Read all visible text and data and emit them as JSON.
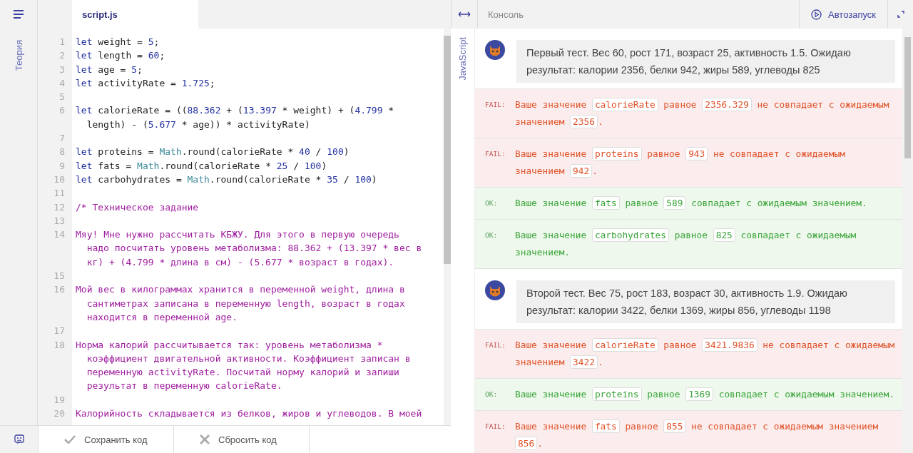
{
  "sidebar": {
    "label": "Теория"
  },
  "editor": {
    "tab": "script.js",
    "lines": [
      {
        "n": "1",
        "tokens": [
          {
            "kind": "kw",
            "t": "let"
          },
          {
            "kind": "id",
            "t": " weight = "
          },
          {
            "kind": "num",
            "t": "5"
          },
          {
            "kind": "id",
            "t": ";"
          }
        ]
      },
      {
        "n": "2",
        "tokens": [
          {
            "kind": "kw",
            "t": "let"
          },
          {
            "kind": "id",
            "t": " length = "
          },
          {
            "kind": "num",
            "t": "60"
          },
          {
            "kind": "id",
            "t": ";"
          }
        ]
      },
      {
        "n": "3",
        "tokens": [
          {
            "kind": "kw",
            "t": "let"
          },
          {
            "kind": "id",
            "t": " age = "
          },
          {
            "kind": "num",
            "t": "5"
          },
          {
            "kind": "id",
            "t": ";"
          }
        ]
      },
      {
        "n": "4",
        "tokens": [
          {
            "kind": "kw",
            "t": "let"
          },
          {
            "kind": "id",
            "t": " activityRate = "
          },
          {
            "kind": "num",
            "t": "1.725"
          },
          {
            "kind": "id",
            "t": ";"
          }
        ]
      },
      {
        "n": "5"
      },
      {
        "n": "6",
        "tokens": [
          {
            "kind": "kw",
            "t": "let"
          },
          {
            "kind": "id",
            "t": " calorieRate = (("
          },
          {
            "kind": "num",
            "t": "88.362"
          },
          {
            "kind": "id",
            "t": " + ("
          },
          {
            "kind": "num",
            "t": "13.397"
          },
          {
            "kind": "id",
            "t": " * weight) + ("
          },
          {
            "kind": "num",
            "t": "4.799"
          },
          {
            "kind": "id",
            "t": " * length) - ("
          },
          {
            "kind": "num",
            "t": "5.677"
          },
          {
            "kind": "id",
            "t": " * age)) * activityRate)"
          }
        ]
      },
      {
        "n": "7"
      },
      {
        "n": "8",
        "tokens": [
          {
            "kind": "kw",
            "t": "let"
          },
          {
            "kind": "id",
            "t": " proteins = "
          },
          {
            "kind": "fn",
            "t": "Math"
          },
          {
            "kind": "id",
            "t": ".round(calorieRate * "
          },
          {
            "kind": "num",
            "t": "40"
          },
          {
            "kind": "id",
            "t": " / "
          },
          {
            "kind": "num",
            "t": "100"
          },
          {
            "kind": "id",
            "t": ")"
          }
        ]
      },
      {
        "n": "9",
        "tokens": [
          {
            "kind": "kw",
            "t": "let"
          },
          {
            "kind": "id",
            "t": " fats = "
          },
          {
            "kind": "fn",
            "t": "Math"
          },
          {
            "kind": "id",
            "t": ".round(calorieRate * "
          },
          {
            "kind": "num",
            "t": "25"
          },
          {
            "kind": "id",
            "t": " / "
          },
          {
            "kind": "num",
            "t": "100"
          },
          {
            "kind": "id",
            "t": ")"
          }
        ]
      },
      {
        "n": "10",
        "tokens": [
          {
            "kind": "kw",
            "t": "let"
          },
          {
            "kind": "id",
            "t": " carbohydrates = "
          },
          {
            "kind": "fn",
            "t": "Math"
          },
          {
            "kind": "id",
            "t": ".round(calorieRate * "
          },
          {
            "kind": "num",
            "t": "35"
          },
          {
            "kind": "id",
            "t": " / "
          },
          {
            "kind": "num",
            "t": "100"
          },
          {
            "kind": "id",
            "t": ")"
          }
        ]
      },
      {
        "n": "11"
      },
      {
        "n": "12",
        "tokens": [
          {
            "kind": "comment",
            "t": "/* Техническое задание"
          }
        ]
      },
      {
        "n": "13"
      },
      {
        "n": "14",
        "tokens": [
          {
            "kind": "comment",
            "t": "Мяу! Мне нужно рассчитать КБЖУ. Для этого в первую очередь надо посчитать уровень метаболизма: 88.362 + (13.397 * вес в кг) + (4.799 * длина в см) - (5.677 * возраст в годах)."
          }
        ]
      },
      {
        "n": "15"
      },
      {
        "n": "16",
        "tokens": [
          {
            "kind": "comment",
            "t": "Мой вес в килограммах хранится в переменной weight, длина в сантиметрах записана в переменную length, возраст в годах находится в переменной age."
          }
        ]
      },
      {
        "n": "17"
      },
      {
        "n": "18",
        "tokens": [
          {
            "kind": "comment",
            "t": "Норма калорий рассчитывается так: уровень метаболизма * коэффициент двигательной активности. Коэффициент записан в переменную activityRate. Посчитай норму калорий и запиши результат в переменную calorieRate."
          }
        ]
      },
      {
        "n": "19"
      },
      {
        "n": "20",
        "tokens": [
          {
            "kind": "comment",
            "t": "Калорийность складывается из белков, жиров и углеводов. В моей"
          }
        ]
      }
    ]
  },
  "footer": {
    "save": "Сохранить код",
    "reset": "Сбросить код"
  },
  "language": "JavaScript",
  "console": {
    "title": "Консоль",
    "autorun": "Автозапуск",
    "messages": [
      {
        "kind": "test",
        "text": "Первый тест. Вес 60, рост 171, возраст 25, активность 1.5. Ожидаю результат: калории 2356, белки 942, жиры 589, углеводы 825"
      },
      {
        "kind": "fail",
        "label": "FAIL:",
        "parts": [
          {
            "kind": "text",
            "t": "Ваше значение "
          },
          {
            "kind": "code",
            "t": "calorieRate"
          },
          {
            "kind": "text",
            "t": " равное "
          },
          {
            "kind": "code",
            "t": "2356.329"
          },
          {
            "kind": "text",
            "t": " не совпадает с ожидаемым значением "
          },
          {
            "kind": "code",
            "t": "2356"
          },
          {
            "kind": "text",
            "t": "."
          }
        ]
      },
      {
        "kind": "fail",
        "label": "FAIL:",
        "parts": [
          {
            "kind": "text",
            "t": "Ваше значение "
          },
          {
            "kind": "code",
            "t": "proteins"
          },
          {
            "kind": "text",
            "t": " равное "
          },
          {
            "kind": "code",
            "t": "943"
          },
          {
            "kind": "text",
            "t": " не совпадает с ожидаемым значением "
          },
          {
            "kind": "code",
            "t": "942"
          },
          {
            "kind": "text",
            "t": "."
          }
        ]
      },
      {
        "kind": "ok",
        "label": "OK:",
        "parts": [
          {
            "kind": "text",
            "t": "Ваше значение "
          },
          {
            "kind": "code",
            "t": "fats"
          },
          {
            "kind": "text",
            "t": " равное "
          },
          {
            "kind": "code",
            "t": "589"
          },
          {
            "kind": "text",
            "t": " совпадает с ожидаемым значением."
          }
        ]
      },
      {
        "kind": "ok",
        "label": "OK:",
        "parts": [
          {
            "kind": "text",
            "t": "Ваше значение "
          },
          {
            "kind": "code",
            "t": "carbohydrates"
          },
          {
            "kind": "text",
            "t": " равное "
          },
          {
            "kind": "code",
            "t": "825"
          },
          {
            "kind": "text",
            "t": " совпадает с ожидаемым значением."
          }
        ]
      },
      {
        "kind": "test",
        "text": "Второй тест. Вес 75, рост 183, возраст 30, активность 1.9. Ожидаю результат: калории 3422, белки 1369, жиры 856, углеводы 1198"
      },
      {
        "kind": "fail",
        "label": "FAIL:",
        "parts": [
          {
            "kind": "text",
            "t": "Ваше значение "
          },
          {
            "kind": "code",
            "t": "calorieRate"
          },
          {
            "kind": "text",
            "t": " равное "
          },
          {
            "kind": "code",
            "t": "3421.9836"
          },
          {
            "kind": "text",
            "t": " не совпадает с ожидаемым значением "
          },
          {
            "kind": "code",
            "t": "3422"
          },
          {
            "kind": "text",
            "t": "."
          }
        ]
      },
      {
        "kind": "ok",
        "label": "OK:",
        "parts": [
          {
            "kind": "text",
            "t": "Ваше значение "
          },
          {
            "kind": "code",
            "t": "proteins"
          },
          {
            "kind": "text",
            "t": " равное "
          },
          {
            "kind": "code",
            "t": "1369"
          },
          {
            "kind": "text",
            "t": " совпадает с ожидаемым значением."
          }
        ]
      },
      {
        "kind": "fail",
        "label": "FAIL:",
        "parts": [
          {
            "kind": "text",
            "t": "Ваше значение "
          },
          {
            "kind": "code",
            "t": "fats"
          },
          {
            "kind": "text",
            "t": " равное "
          },
          {
            "kind": "code",
            "t": "855"
          },
          {
            "kind": "text",
            "t": " не совпадает с ожидаемым значением "
          },
          {
            "kind": "code",
            "t": "856"
          },
          {
            "kind": "text",
            "t": "."
          }
        ]
      }
    ]
  }
}
